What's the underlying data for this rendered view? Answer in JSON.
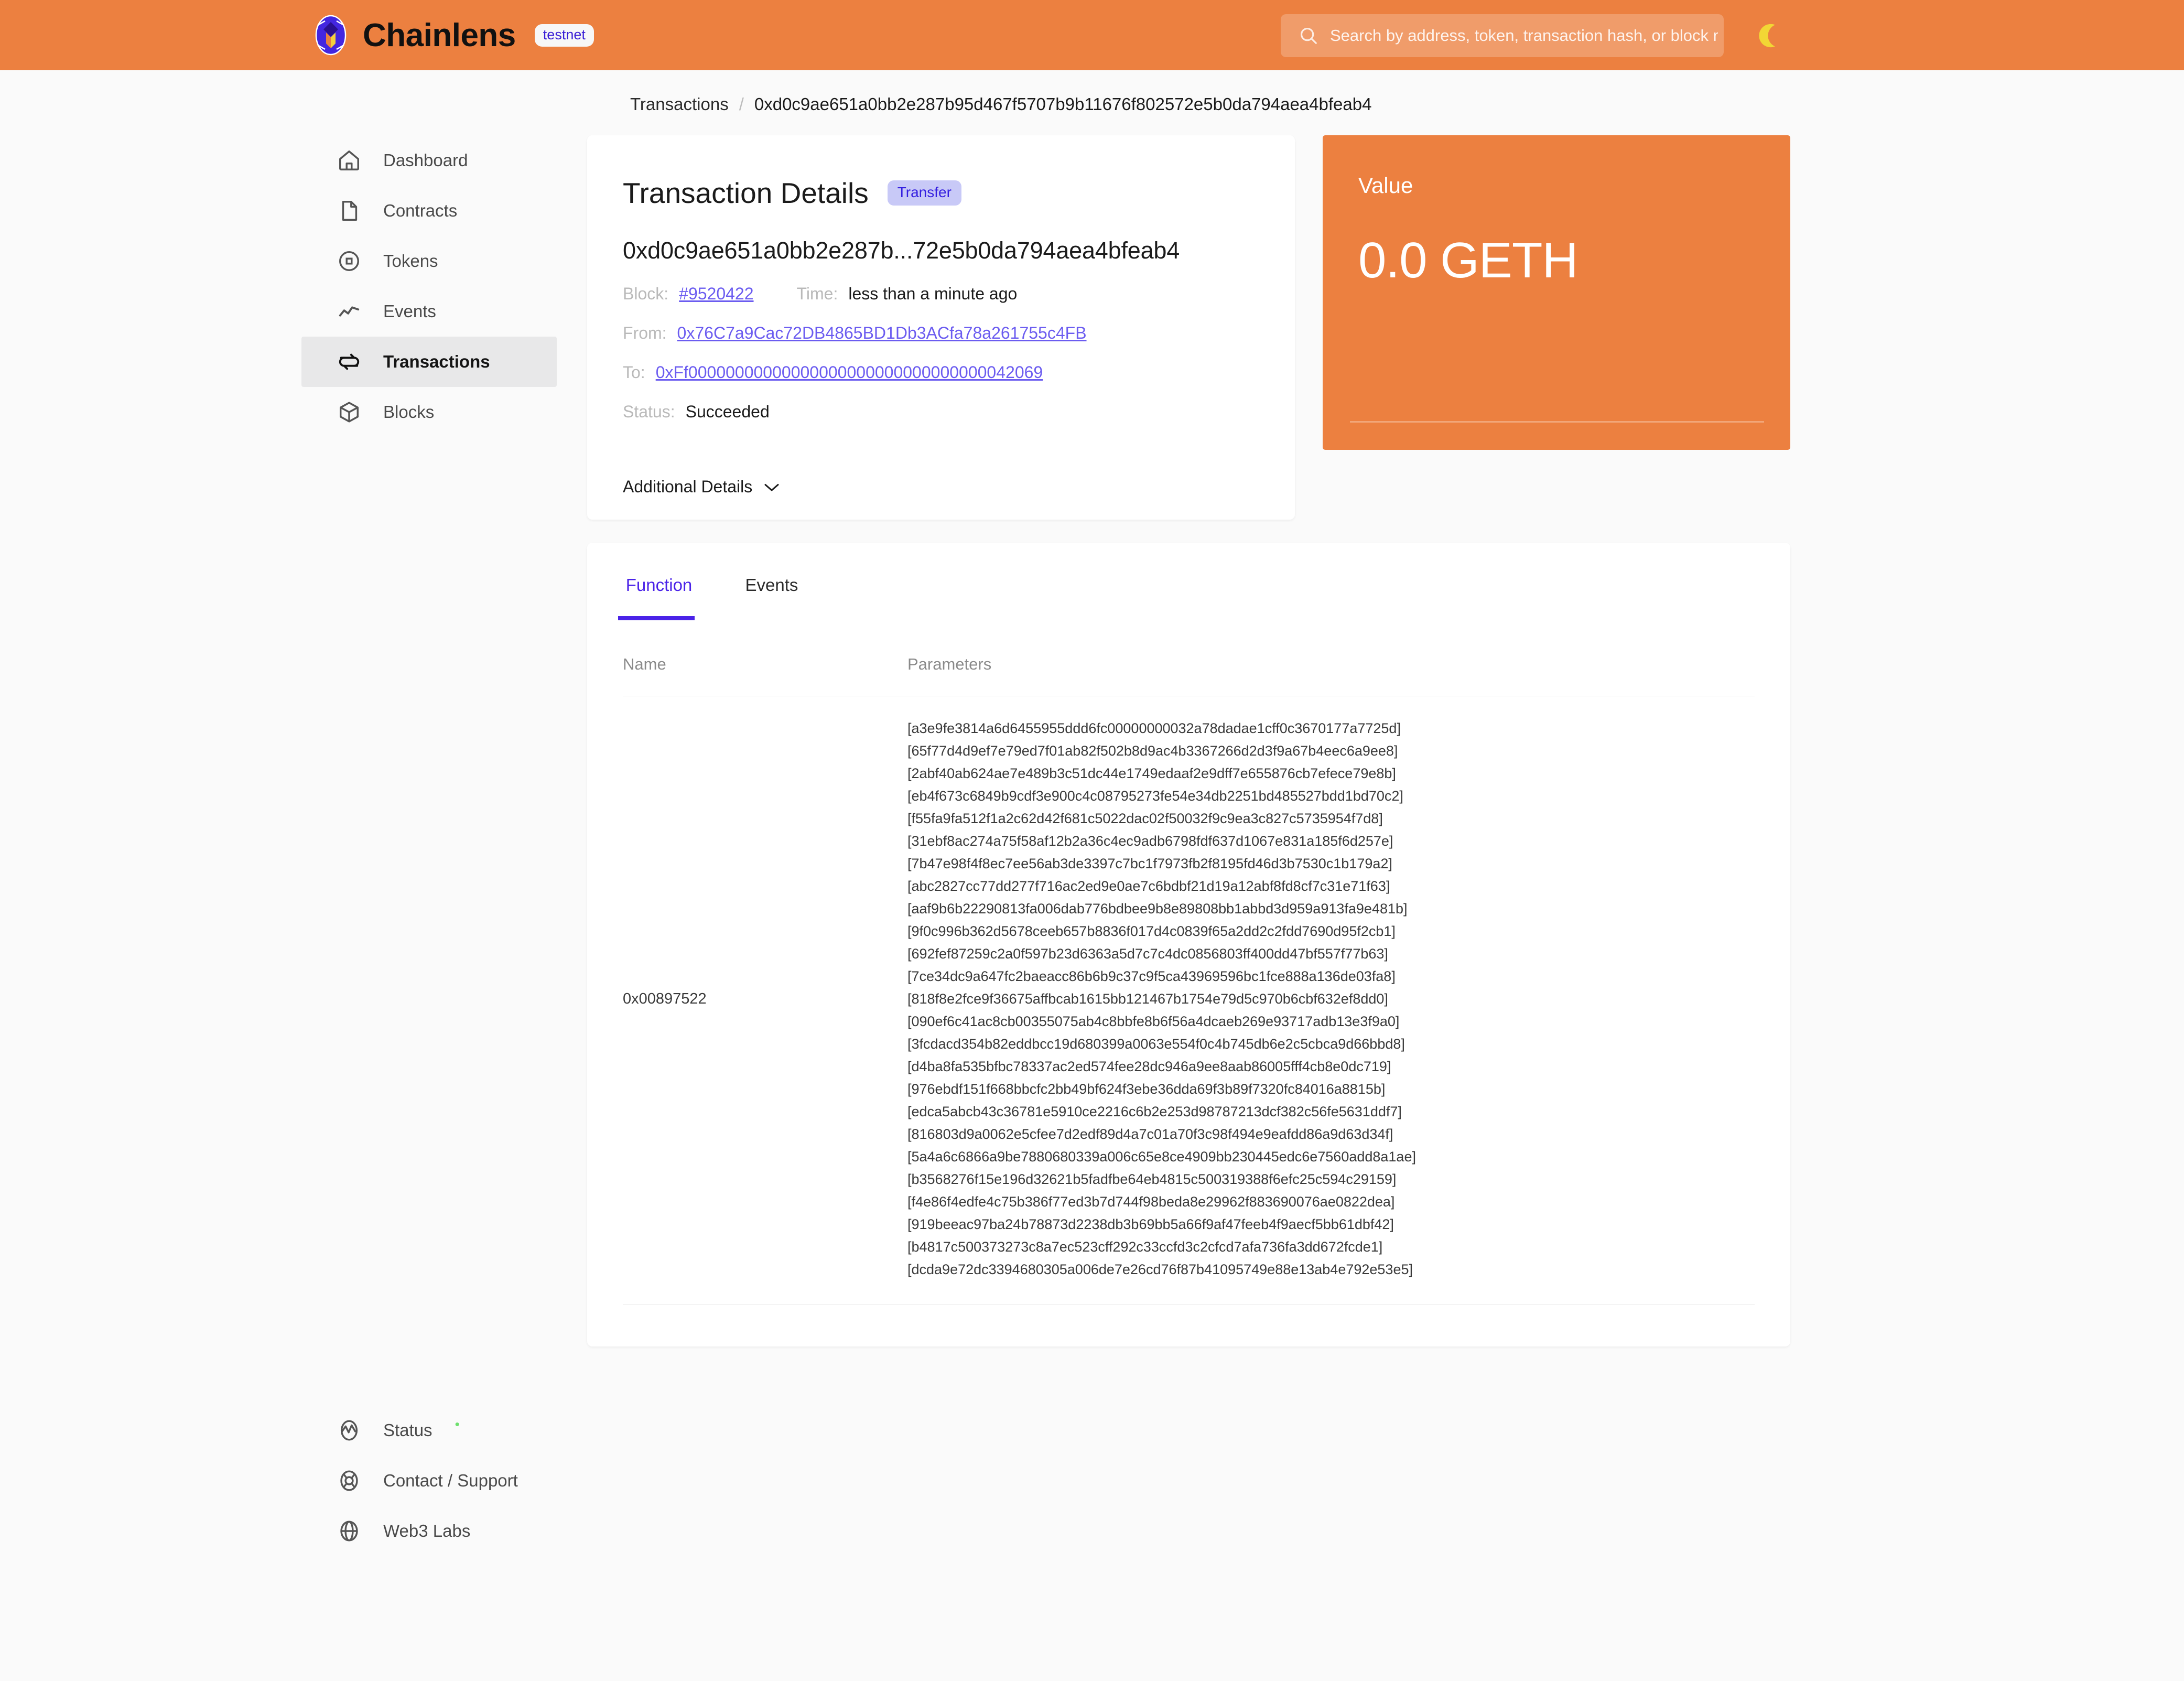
{
  "header": {
    "brand_name": "Chainlens",
    "network_badge": "testnet",
    "logo_icon": "chainlens-logo-icon",
    "search": {
      "placeholder": "Search by address, token, transaction hash, or block number",
      "value": "",
      "icon": "search-icon"
    },
    "theme_toggle_icon": "moon-icon",
    "background_color": "#ec8040"
  },
  "breadcrumb": {
    "parent": "Transactions",
    "separator": "/",
    "current": "0xd0c9ae651a0bb2e287b95d467f5707b9b11676f802572e5b0da794aea4bfeab4"
  },
  "sidebar": {
    "items": [
      {
        "label": "Dashboard",
        "icon": "home-icon",
        "active": false
      },
      {
        "label": "Contracts",
        "icon": "document-icon",
        "active": false
      },
      {
        "label": "Tokens",
        "icon": "token-circle-icon",
        "active": false
      },
      {
        "label": "Events",
        "icon": "chart-line-icon",
        "active": false
      },
      {
        "label": "Transactions",
        "icon": "swap-arrows-icon",
        "active": true
      },
      {
        "label": "Blocks",
        "icon": "cube-icon",
        "active": false
      }
    ],
    "footer_items": [
      {
        "label": "Status",
        "icon": "pulse-icon",
        "dot": "•",
        "dot_color": "#6ee06e"
      },
      {
        "label": "Contact / Support",
        "icon": "lifebuoy-icon",
        "dot": "",
        "dot_color": ""
      },
      {
        "label": "Web3 Labs",
        "icon": "globe-icon",
        "dot": "",
        "dot_color": ""
      }
    ]
  },
  "transaction_details": {
    "title": "Transaction Details",
    "type_badge": "Transfer",
    "hash_display": "0xd0c9ae651a0bb2e287b...72e5b0da794aea4bfeab4",
    "block_label": "Block:",
    "block_value": "#9520422",
    "time_label": "Time:",
    "time_value": "less than a minute ago",
    "from_label": "From:",
    "from_value": "0x76C7a9Cac72DB4865BD1Db3ACfa78a261755c4FB",
    "to_label": "To:",
    "to_value": "0xFf00000000000000000000000000000000042069",
    "status_label": "Status:",
    "status_value": "Succeeded",
    "additional_details_label": "Additional Details",
    "chevron_icon": "chevron-down-icon",
    "link_color": "#6b5cf0"
  },
  "value_card": {
    "label": "Value",
    "amount": "0.0 GETH",
    "background_color": "#ec8040"
  },
  "function_panel": {
    "tabs": [
      {
        "label": "Function",
        "active": true
      },
      {
        "label": "Events",
        "active": false
      }
    ],
    "active_tab_color": "#4a22e8",
    "columns": {
      "name": "Name",
      "parameters": "Parameters"
    },
    "rows": [
      {
        "name": "0x00897522",
        "parameters": [
          "[a3e9fe3814a6d6455955ddd6fc00000000032a78dadae1cff0c3670177a7725d]",
          "[65f77d4d9ef7e79ed7f01ab82f502b8d9ac4b3367266d2d3f9a67b4eec6a9ee8]",
          "[2abf40ab624ae7e489b3c51dc44e1749edaaf2e9dff7e655876cb7efece79e8b]",
          "[eb4f673c6849b9cdf3e900c4c08795273fe54e34db2251bd485527bdd1bd70c2]",
          "[f55fa9fa512f1a2c62d42f681c5022dac02f50032f9c9ea3c827c5735954f7d8]",
          "[31ebf8ac274a75f58af12b2a36c4ec9adb6798fdf637d1067e831a185f6d257e]",
          "[7b47e98f4f8ec7ee56ab3de3397c7bc1f7973fb2f8195fd46d3b7530c1b179a2]",
          "[abc2827cc77dd277f716ac2ed9e0ae7c6bdbf21d19a12abf8fd8cf7c31e71f63]",
          "[aaf9b6b22290813fa006dab776bdbee9b8e89808bb1abbd3d959a913fa9e481b]",
          "[9f0c996b362d5678ceeb657b8836f017d4c0839f65a2dd2c2fdd7690d95f2cb1]",
          "[692fef87259c2a0f597b23d6363a5d7c7c4dc0856803ff400dd47bf557f77b63]",
          "[7ce34dc9a647fc2baeacc86b6b9c37c9f5ca43969596bc1fce888a136de03fa8]",
          "[818f8e2fce9f36675affbcab1615bb121467b1754e79d5c970b6cbf632ef8dd0]",
          "[090ef6c41ac8cb00355075ab4c8bbfe8b6f56a4dcaeb269e93717adb13e3f9a0]",
          "[3fcdacd354b82eddbcc19d680399a0063e554f0c4b745db6e2c5cbca9d66bbd8]",
          "[d4ba8fa535bfbc78337ac2ed574fee28dc946a9ee8aab86005fff4cb8e0dc719]",
          "[976ebdf151f668bbcfc2bb49bf624f3ebe36dda69f3b89f7320fc84016a8815b]",
          "[edca5abcb43c36781e5910ce2216c6b2e253d98787213dcf382c56fe5631ddf7]",
          "[816803d9a0062e5cfee7d2edf89d4a7c01a70f3c98f494e9eafdd86a9d63d34f]",
          "[5a4a6c6866a9be7880680339a006c65e8ce4909bb230445edc6e7560add8a1ae]",
          "[b3568276f15e196d32621b5fadfbe64eb4815c500319388f6efc25c594c29159]",
          "[f4e86f4edfe4c75b386f77ed3b7d744f98beda8e29962f883690076ae0822dea]",
          "[919beeac97ba24b78873d2238db3b69bb5a66f9af47feeb4f9aecf5bb61dbf42]",
          "[b4817c500373273c8a7ec523cff292c33ccfd3c2cfcd7afa736fa3dd672fcde1]",
          "[dcda9e72dc3394680305a006de7e26cd76f87b41095749e88e13ab4e792e53e5]"
        ]
      }
    ]
  }
}
